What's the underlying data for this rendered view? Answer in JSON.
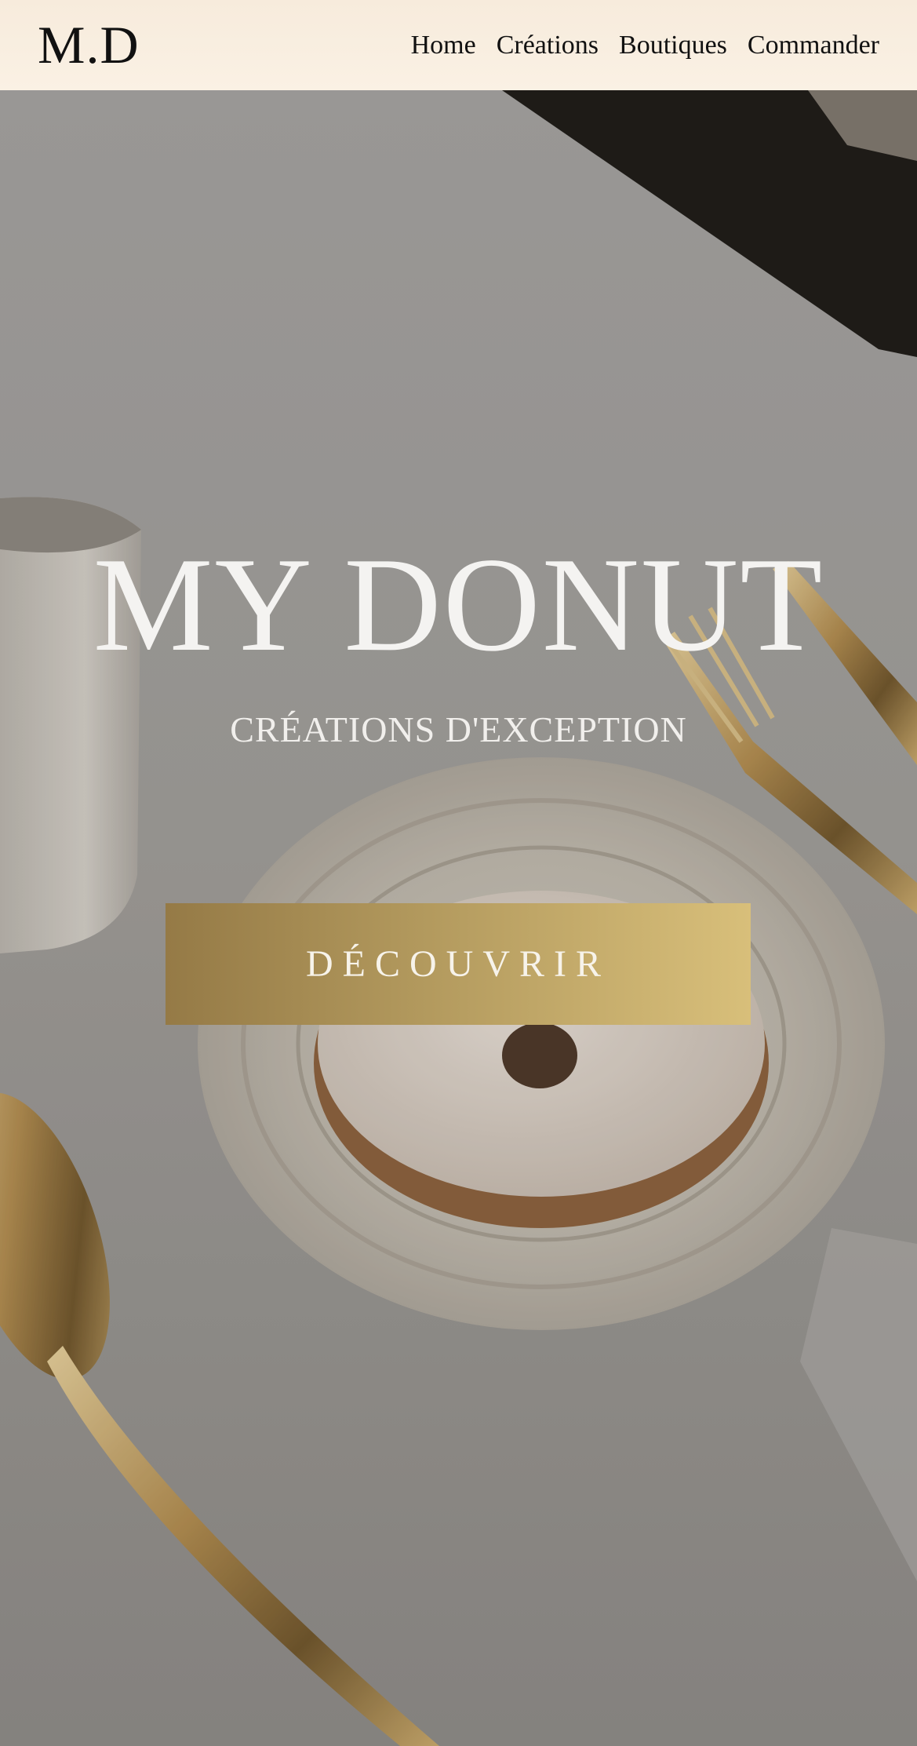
{
  "header": {
    "logo": "M.D",
    "nav": [
      {
        "label": "Home"
      },
      {
        "label": "Créations"
      },
      {
        "label": "Boutiques"
      },
      {
        "label": "Commander"
      }
    ]
  },
  "hero": {
    "title": "MY DONUT",
    "subtitle": "CRÉATIONS D'EXCEPTION",
    "cta_label": "DÉCOUVRIR"
  },
  "colors": {
    "header_bg": "#f8eee0",
    "cta_gradient_start": "#957a46",
    "cta_gradient_end": "#d8bf7a",
    "hero_text": "#f4f3f1"
  }
}
